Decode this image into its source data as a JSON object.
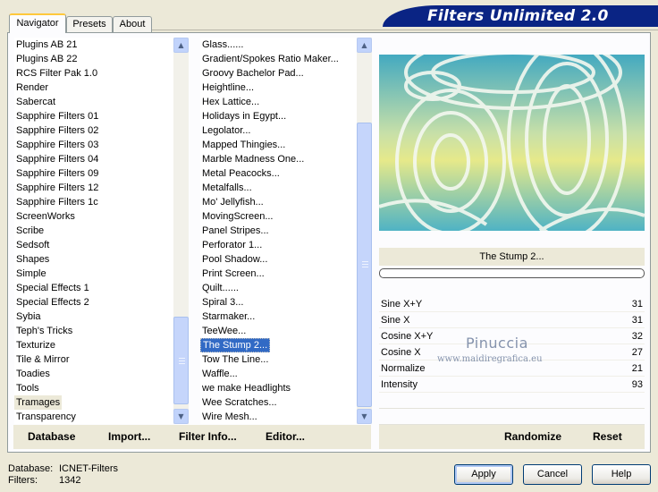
{
  "header": {
    "title": "Filters Unlimited 2.0"
  },
  "tabs": [
    {
      "label": "Navigator",
      "active": true
    },
    {
      "label": "Presets",
      "active": false
    },
    {
      "label": "About",
      "active": false
    }
  ],
  "categories": {
    "items": [
      "Plugins AB 21",
      "Plugins AB 22",
      "RCS Filter Pak 1.0",
      "Render",
      "Sabercat",
      "Sapphire Filters 01",
      "Sapphire Filters 02",
      "Sapphire Filters 03",
      "Sapphire Filters 04",
      "Sapphire Filters 09",
      "Sapphire Filters 12",
      "Sapphire Filters 1c",
      "ScreenWorks",
      "Scribe",
      "Sedsoft",
      "Shapes",
      "Simple",
      "Special Effects 1",
      "Special Effects 2",
      "Sybia",
      "Teph's Tricks",
      "Texturize",
      "Tile & Mirror",
      "Toadies",
      "Tools",
      "Tramages",
      "Transparency"
    ],
    "selected": "Tramages"
  },
  "filters": {
    "items": [
      "Glass......",
      "Gradient/Spokes Ratio Maker...",
      "Groovy Bachelor Pad...",
      "Heightline...",
      "Hex Lattice...",
      "Holidays in Egypt...",
      "Legolator...",
      "Mapped Thingies...",
      "Marble Madness One...",
      "Metal Peacocks...",
      "Metalfalls...",
      "Mo' Jellyfish...",
      "MovingScreen...",
      "Panel Stripes...",
      "Perforator 1...",
      "Pool Shadow...",
      "Print Screen...",
      "Quilt......",
      "Spiral 3...",
      "Starmaker...",
      "TeeWee...",
      "The Stump 2...",
      "Tow The Line...",
      "Waffle...",
      "we make Headlights",
      "Wee Scratches...",
      "Wire Mesh..."
    ],
    "selected": "The Stump 2..."
  },
  "preview": {
    "filter_name": "The Stump 2...",
    "progress": 0
  },
  "params": [
    {
      "name": "Sine X+Y",
      "value": "31"
    },
    {
      "name": "Sine X",
      "value": "31"
    },
    {
      "name": "Cosine X+Y",
      "value": "32"
    },
    {
      "name": "Cosine X",
      "value": "27"
    },
    {
      "name": "Normalize",
      "value": "21"
    },
    {
      "name": "Intensity",
      "value": "93"
    }
  ],
  "watermark": {
    "name": "Pinuccia",
    "url": "www.maidiregrafica.eu"
  },
  "toolbar": {
    "database": "Database",
    "import": "Import...",
    "filter_info": "Filter Info...",
    "editor": "Editor...",
    "randomize": "Randomize",
    "reset": "Reset"
  },
  "footer": {
    "database_label": "Database:",
    "database_value": "ICNET-Filters",
    "filters_label": "Filters:",
    "filters_value": "1342",
    "apply": "Apply",
    "cancel": "Cancel",
    "help": "Help"
  },
  "colors": {
    "banner": "#0a2484",
    "selection": "#316ac5",
    "preview_yellow": "#e6e98a",
    "preview_teal": "#4fb3c4"
  }
}
